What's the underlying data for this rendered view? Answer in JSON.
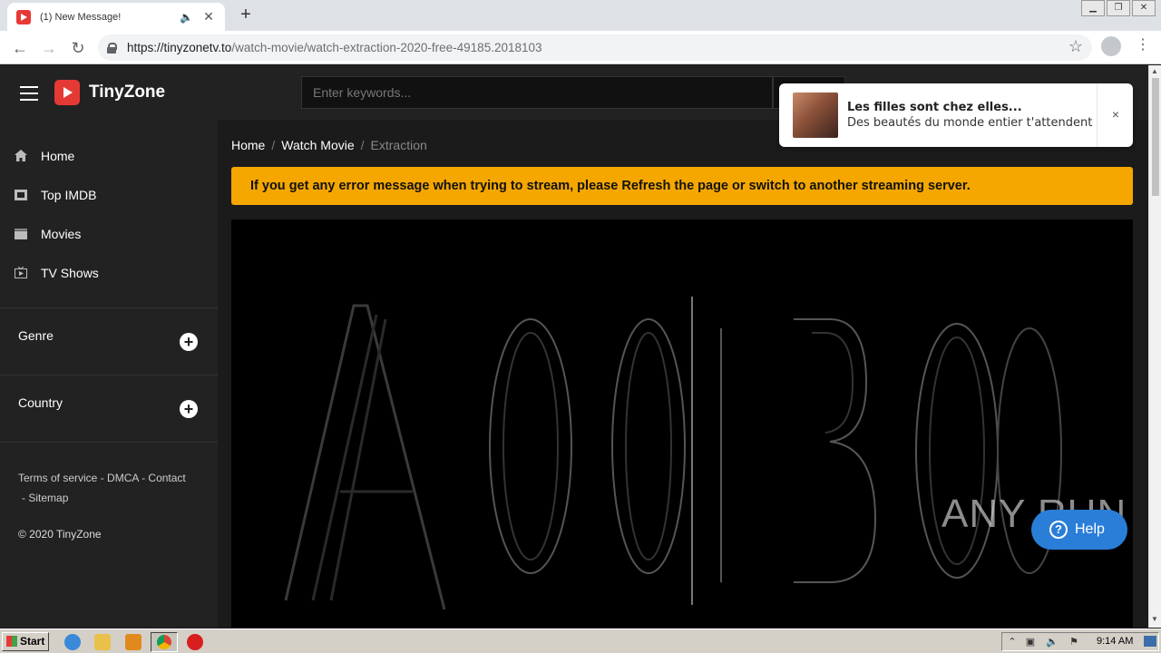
{
  "browser": {
    "tab_title": "(1) New Message!",
    "new_tab_label": "+",
    "url_host": "https://tinyzonetv.to",
    "url_path": "/watch-movie/watch-extraction-2020-free-49185.2018103"
  },
  "site": {
    "brand": "TinyZone",
    "search_placeholder": "Enter keywords...",
    "menu": [
      {
        "label": "Home",
        "icon": "home-icon"
      },
      {
        "label": "Top IMDB",
        "icon": "imdb-icon"
      },
      {
        "label": "Movies",
        "icon": "movie-icon"
      },
      {
        "label": "TV Shows",
        "icon": "tv-icon"
      }
    ],
    "genre_label": "Genre",
    "country_label": "Country",
    "footer_links": {
      "terms": "Terms of service",
      "dmca": "DMCA",
      "contact": "Contact",
      "sitemap": "Sitemap",
      "separator": "-"
    },
    "copyright": "© 2020 TinyZone",
    "breadcrumb": {
      "home": "Home",
      "watch_movie": "Watch Movie",
      "current": "Extraction",
      "separator": "/"
    },
    "alert": "If you get any error message when trying to stream, please Refresh the page or switch to another streaming server.",
    "help_label": "Help",
    "accent_color": "#f5a700",
    "brand_color": "#e53935"
  },
  "notification": {
    "title": "Les filles sont chez elles...",
    "body": "Des beautés du monde entier t'attendent",
    "close": "×"
  },
  "watermark": "ANY RUN",
  "taskbar": {
    "start": "Start",
    "clock": "9:14 AM"
  }
}
